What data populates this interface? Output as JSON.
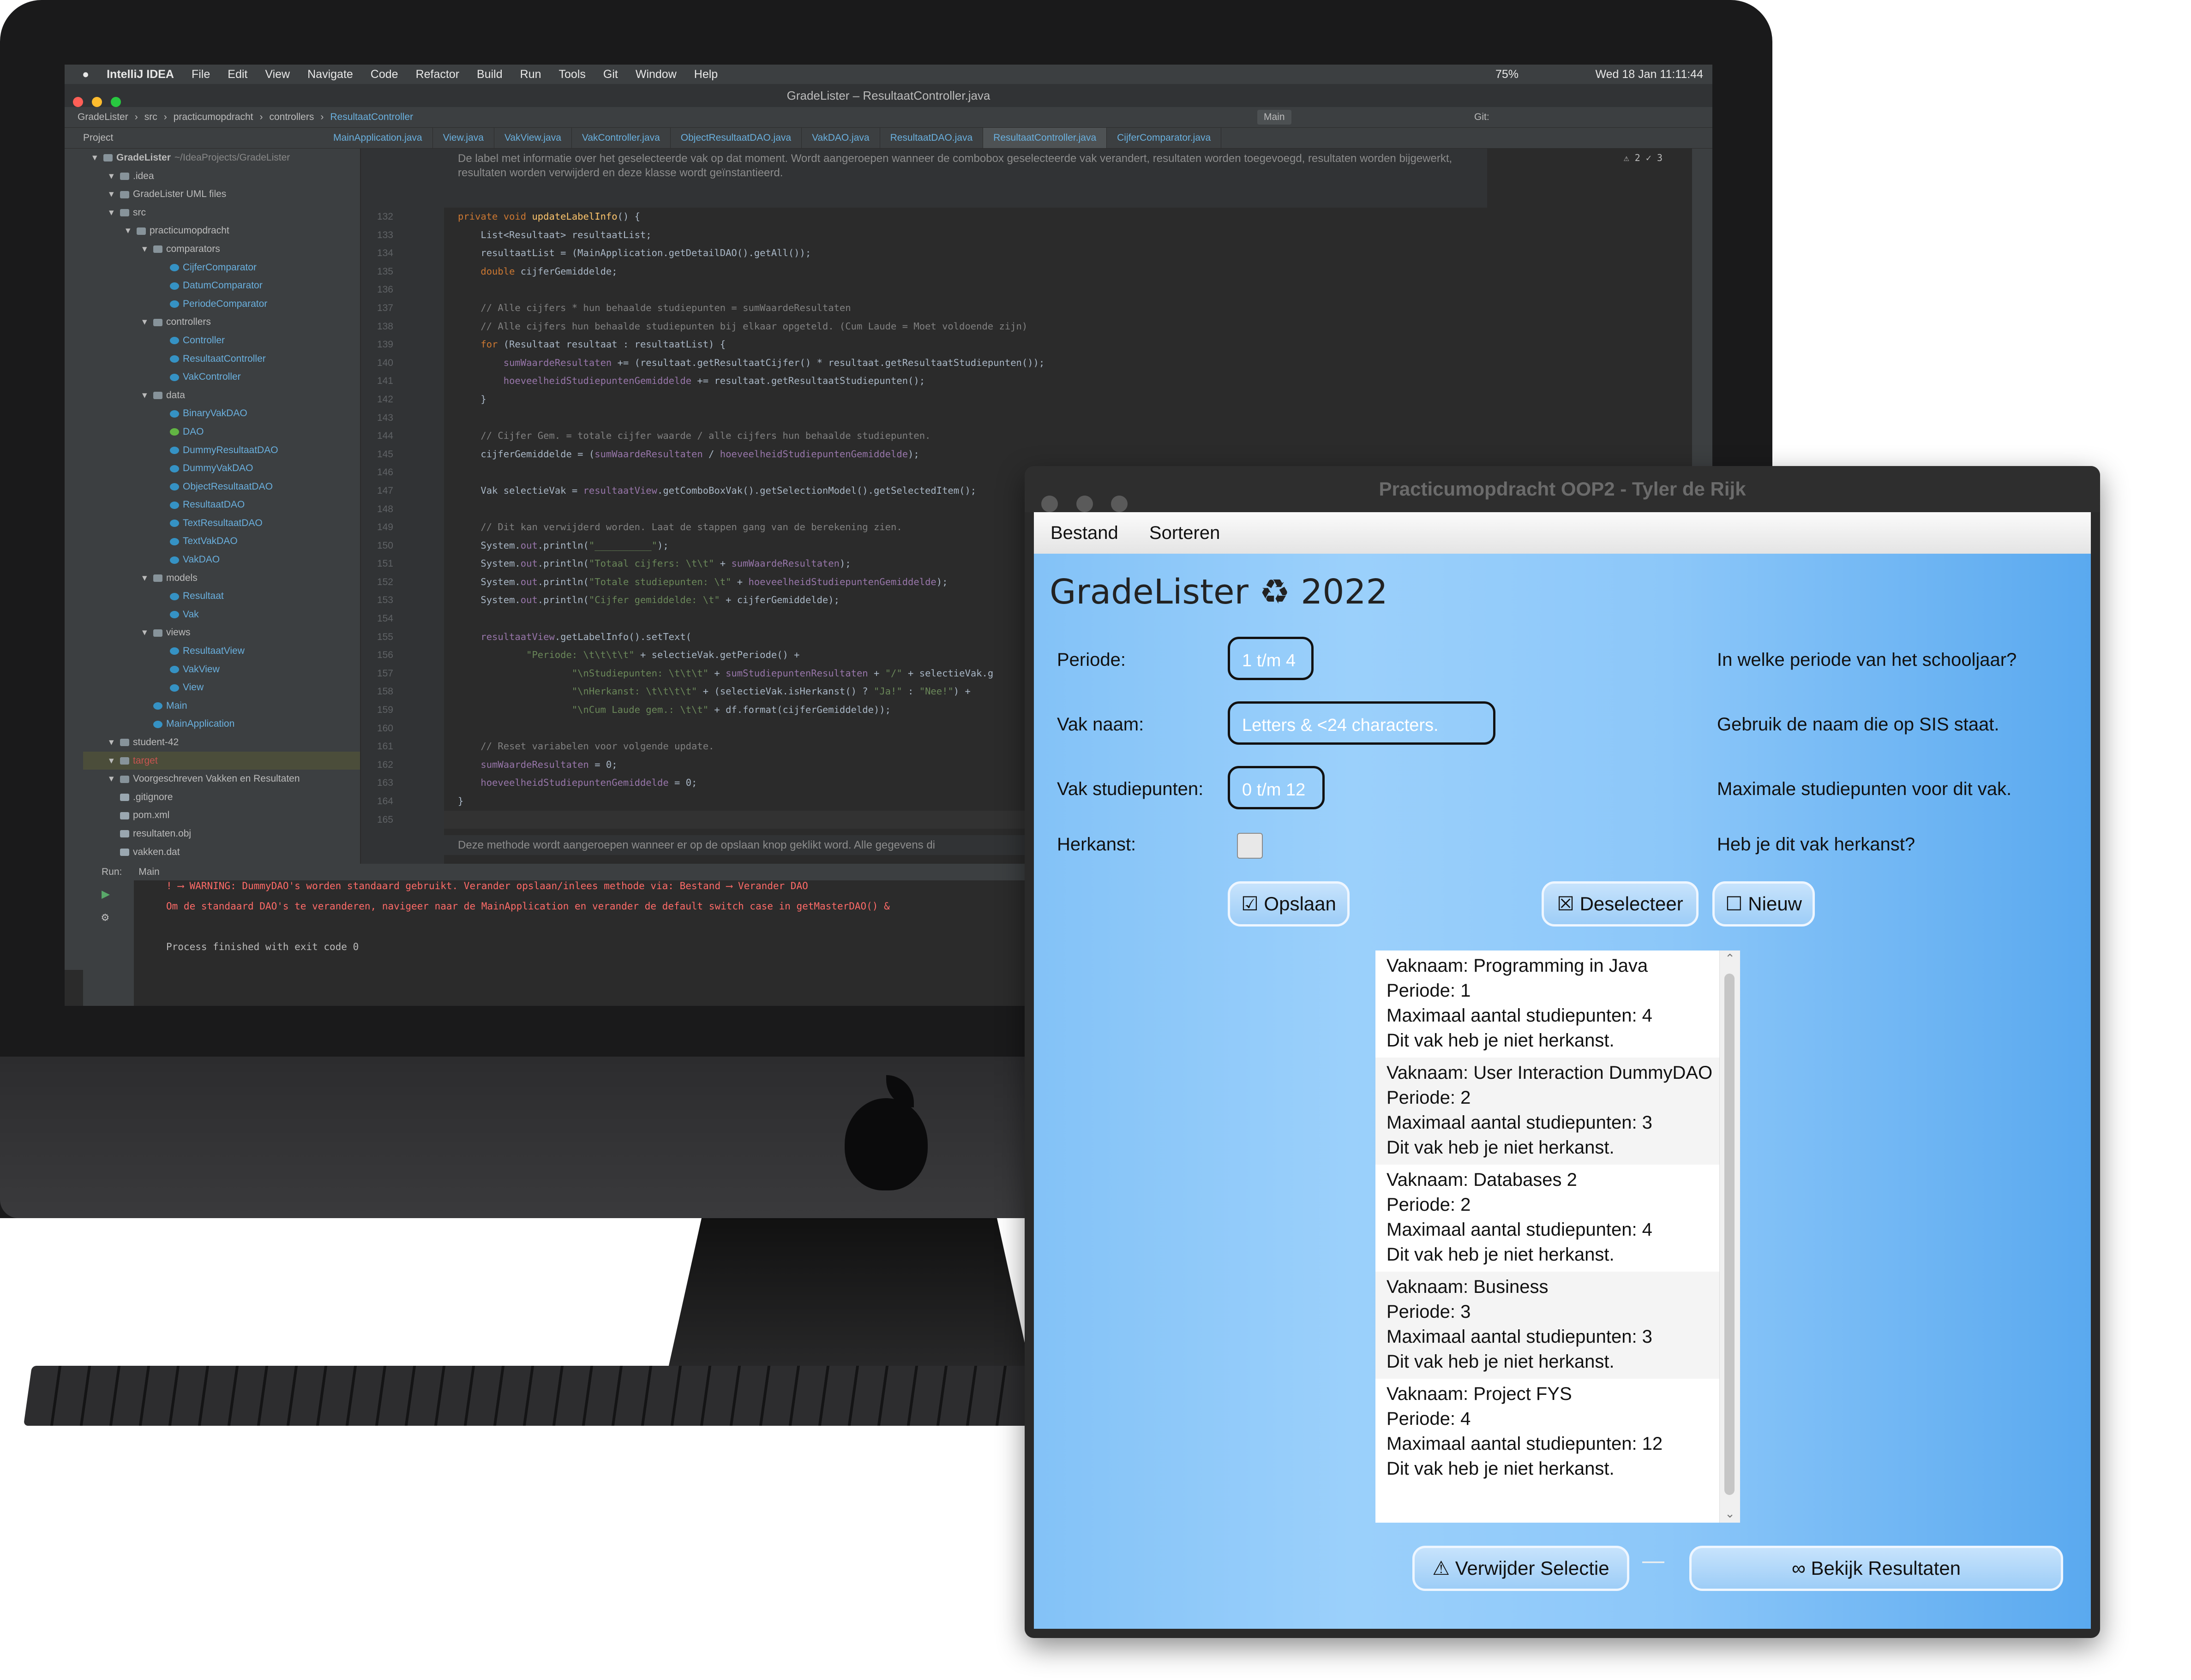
{
  "mac_menubar": {
    "app": "IntelliJ IDEA",
    "menus": [
      "File",
      "Edit",
      "View",
      "Navigate",
      "Code",
      "Refactor",
      "Build",
      "Run",
      "Tools",
      "Git",
      "Window",
      "Help"
    ],
    "battery": "75%",
    "clock": "Wed 18 Jan 11:11:44"
  },
  "ide": {
    "window_title": "GradeLister – ResultaatController.java",
    "breadcrumb": [
      "GradeLister",
      "src",
      "practicumopdracht",
      "controllers",
      "ResultaatController"
    ],
    "run_config": "Main",
    "git_label": "Git:",
    "project_tab": "Project",
    "tabs": [
      "MainApplication.java",
      "View.java",
      "VakView.java",
      "VakController.java",
      "ObjectResultaatDAO.java",
      "VakDAO.java",
      "ResultaatDAO.java",
      "ResultaatController.java",
      "CijferComparator.java"
    ],
    "active_tab": "ResultaatController.java",
    "warnings": "⚠ 2  ✓ 3",
    "tree": [
      {
        "label": "GradeLister",
        "extra": "~/IdeaProjects/GradeLister",
        "indent": 0,
        "kind": "folder"
      },
      {
        "label": ".idea",
        "indent": 1,
        "kind": "folder"
      },
      {
        "label": "GradeLister UML files",
        "indent": 1,
        "kind": "folder"
      },
      {
        "label": "src",
        "indent": 1,
        "kind": "folder"
      },
      {
        "label": "practicumopdracht",
        "indent": 2,
        "kind": "folder"
      },
      {
        "label": "comparators",
        "indent": 3,
        "kind": "folder"
      },
      {
        "label": "CijferComparator",
        "indent": 4,
        "kind": "java"
      },
      {
        "label": "DatumComparator",
        "indent": 4,
        "kind": "java"
      },
      {
        "label": "PeriodeComparator",
        "indent": 4,
        "kind": "java"
      },
      {
        "label": "controllers",
        "indent": 3,
        "kind": "folder"
      },
      {
        "label": "Controller",
        "indent": 4,
        "kind": "java"
      },
      {
        "label": "ResultaatController",
        "indent": 4,
        "kind": "java"
      },
      {
        "label": "VakController",
        "indent": 4,
        "kind": "java"
      },
      {
        "label": "data",
        "indent": 3,
        "kind": "folder"
      },
      {
        "label": "BinaryVakDAO",
        "indent": 4,
        "kind": "java"
      },
      {
        "label": "DAO",
        "indent": 4,
        "kind": "iface"
      },
      {
        "label": "DummyResultaatDAO",
        "indent": 4,
        "kind": "java"
      },
      {
        "label": "DummyVakDAO",
        "indent": 4,
        "kind": "java"
      },
      {
        "label": "ObjectResultaatDAO",
        "indent": 4,
        "kind": "java"
      },
      {
        "label": "ResultaatDAO",
        "indent": 4,
        "kind": "java"
      },
      {
        "label": "TextResultaatDAO",
        "indent": 4,
        "kind": "java"
      },
      {
        "label": "TextVakDAO",
        "indent": 4,
        "kind": "java"
      },
      {
        "label": "VakDAO",
        "indent": 4,
        "kind": "java"
      },
      {
        "label": "models",
        "indent": 3,
        "kind": "folder"
      },
      {
        "label": "Resultaat",
        "indent": 4,
        "kind": "java"
      },
      {
        "label": "Vak",
        "indent": 4,
        "kind": "java"
      },
      {
        "label": "views",
        "indent": 3,
        "kind": "folder"
      },
      {
        "label": "ResultaatView",
        "indent": 4,
        "kind": "java"
      },
      {
        "label": "VakView",
        "indent": 4,
        "kind": "java"
      },
      {
        "label": "View",
        "indent": 4,
        "kind": "java"
      },
      {
        "label": "Main",
        "indent": 3,
        "kind": "java"
      },
      {
        "label": "MainApplication",
        "indent": 3,
        "kind": "java"
      },
      {
        "label": "student-42",
        "indent": 1,
        "kind": "folder"
      },
      {
        "label": "target",
        "indent": 1,
        "kind": "folder",
        "red": true
      },
      {
        "label": "Voorgeschreven Vakken en Resultaten",
        "indent": 1,
        "kind": "folder"
      },
      {
        "label": ".gitignore",
        "indent": 1,
        "kind": "file"
      },
      {
        "label": "pom.xml",
        "indent": 1,
        "kind": "file"
      },
      {
        "label": "resultaten.obj",
        "indent": 1,
        "kind": "file"
      },
      {
        "label": "vakken.dat",
        "indent": 1,
        "kind": "file"
      }
    ],
    "doc_top": "De label met informatie over het geselecteerde vak op dat moment. Wordt aangeroepen wanneer de combobox geselecteerde vak verandert, resultaten worden toegevoegd, resultaten worden bijgewerkt, resultaten worden verwijderd en deze klasse wordt geïnstantieerd.",
    "line_numbers": [
      "132",
      "133",
      "134",
      "135",
      "136",
      "137",
      "138",
      "139",
      "140",
      "141",
      "142",
      "143",
      "144",
      "145",
      "146",
      "147",
      "148",
      "149",
      "150",
      "151",
      "152",
      "153",
      "154",
      "155",
      "156",
      "157",
      "158",
      "159",
      "160",
      "161",
      "162",
      "163",
      "164",
      "165"
    ],
    "code": [
      "private void updateLabelInfo() {",
      "    List<Resultaat> resultaatList;",
      "    resultaatList = (MainApplication.getDetailDAO().getAll());",
      "    double cijferGemiddelde;",
      "",
      "    // Alle cijfers * hun behaalde studiepunten = sumWaardeResultaten",
      "    // Alle cijfers hun behaalde studiepunten bij elkaar opgeteld. (Cum Laude = Moet voldoende zijn)",
      "    for (Resultaat resultaat : resultaatList) {",
      "        sumWaardeResultaten += (resultaat.getResultaatCijfer() * resultaat.getResultaatStudiepunten());",
      "        hoeveelheidStudiepuntenGemiddelde += resultaat.getResultaatStudiepunten();",
      "    }",
      "",
      "    // Cijfer Gem. = totale cijfer waarde / alle cijfers hun behaalde studiepunten.",
      "    cijferGemiddelde = (sumWaardeResultaten / hoeveelheidStudiepuntenGemiddelde);",
      "",
      "    Vak selectieVak = resultaatView.getComboBoxVak().getSelectionModel().getSelectedItem();",
      "",
      "    // Dit kan verwijderd worden. Laat de stappen gang van de berekening zien.",
      "    System.out.println(\"__________\");",
      "    System.out.println(\"Totaal cijfers: \\t\\t\" + sumWaardeResultaten);",
      "    System.out.println(\"Totale studiepunten: \\t\" + hoeveelheidStudiepuntenGemiddelde);",
      "    System.out.println(\"Cijfer gemiddelde: \\t\" + cijferGemiddelde);",
      "",
      "    resultaatView.getLabelInfo().setText(",
      "            \"Periode: \\t\\t\\t\\t\" + selectieVak.getPeriode() +",
      "                    \"\\nStudiepunten: \\t\\t\\t\" + sumStudiepuntenResultaten + \"/\" + selectieVak.g",
      "                    \"\\nHerkanst: \\t\\t\\t\\t\" + (selectieVak.isHerkanst() ? \"Ja!\" : \"Nee!\") +",
      "                    \"\\nCum Laude gem.: \\t\\t\" + df.format(cijferGemiddelde));",
      "",
      "    // Reset variabelen voor volgende update.",
      "    sumWaardeResultaten = 0;",
      "    hoeveelheidStudiepuntenGemiddelde = 0;",
      "}",
      ""
    ],
    "doc_bottom": "Deze methode wordt aangeroepen wanneer er op de opslaan knop geklikt word. Alle gegevens di",
    "run_label": "Run:",
    "run_tab": "Main",
    "run_output": [
      "! ⟶ WARNING: DummyDAO's worden standaard gebruikt. Verander opslaan/inlees methode via: Bestand ⟶ Verander DAO",
      "Om de standaard DAO's te veranderen, navigeer naar de MainApplication en verander de default switch case in getMasterDAO() &",
      "",
      "Process finished with exit code 0"
    ]
  },
  "app": {
    "window_title": "Practicumopdracht OOP2 - Tyler de Rijk",
    "menu": [
      "Bestand",
      "Sorteren"
    ],
    "heading": "GradeLister ♻ 2022",
    "periode_label": "Periode:",
    "periode_placeholder": "1 t/m 4",
    "periode_hint": "In welke periode van het schooljaar?",
    "vaknaam_label": "Vak naam:",
    "vaknaam_placeholder": "Letters & <24 characters.",
    "vaknaam_hint": "Gebruik de naam die op SIS staat.",
    "studiepunten_label": "Vak studiepunten:",
    "studiepunten_placeholder": "0 t/m 12",
    "studiepunten_hint": "Maximale studiepunten voor dit vak.",
    "herkanst_label": "Herkanst:",
    "herkanst_hint": "Heb je dit vak herkanst?",
    "opslaan": "☑ Opslaan",
    "deselecteer": "☒ Deselecteer",
    "nieuw": "☐ Nieuw",
    "vakken": [
      {
        "naam": "Vaknaam: Programming in Java",
        "periode": "Periode: 1",
        "studiepunten": "Maximaal aantal studiepunten:  4",
        "herkanst": "Dit vak heb je niet herkanst."
      },
      {
        "naam": "Vaknaam: User Interaction DummyDAO",
        "periode": "Periode: 2",
        "studiepunten": "Maximaal aantal studiepunten:  3",
        "herkanst": "Dit vak heb je niet herkanst."
      },
      {
        "naam": "Vaknaam: Databases 2",
        "periode": "Periode: 2",
        "studiepunten": "Maximaal aantal studiepunten:  4",
        "herkanst": "Dit vak heb je niet herkanst."
      },
      {
        "naam": "Vaknaam: Business",
        "periode": "Periode: 3",
        "studiepunten": "Maximaal aantal studiepunten:  3",
        "herkanst": "Dit vak heb je niet herkanst."
      },
      {
        "naam": "Vaknaam: Project FYS",
        "periode": "Periode: 4",
        "studiepunten": "Maximaal aantal studiepunten:  12",
        "herkanst": "Dit vak heb je niet herkanst."
      }
    ],
    "verwijder": "⚠ Verwijder Selectie",
    "separator": "—",
    "bekijk": "∞ Bekijk Resultaten"
  }
}
